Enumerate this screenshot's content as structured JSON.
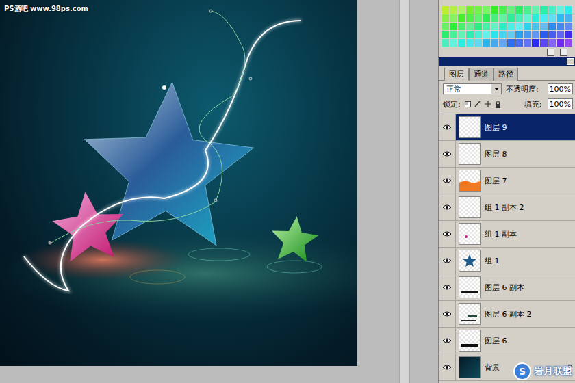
{
  "canvas": {
    "watermark": "PS酒吧 www.98ps.com"
  },
  "layers_panel": {
    "tabs": [
      {
        "label": "图层",
        "selected": true
      },
      {
        "label": "通道",
        "selected": false
      },
      {
        "label": "路径",
        "selected": false
      }
    ],
    "blend_mode": "正常",
    "opacity_label": "不透明度:",
    "opacity": "100%",
    "lock_label": "锁定:",
    "fill_label": "填充:",
    "fill": "100%",
    "layers": [
      {
        "name": "图层 9",
        "visible": true,
        "selected": true,
        "locked": false,
        "kind": "empty"
      },
      {
        "name": "图层 8",
        "visible": true,
        "selected": false,
        "locked": false,
        "kind": "empty"
      },
      {
        "name": "图层 7",
        "visible": true,
        "selected": false,
        "locked": false,
        "kind": "orange"
      },
      {
        "name": "组 1 副本 2",
        "visible": true,
        "selected": false,
        "locked": false,
        "kind": "empty"
      },
      {
        "name": "组 1 副本",
        "visible": true,
        "selected": false,
        "locked": false,
        "kind": "dot"
      },
      {
        "name": "组 1",
        "visible": true,
        "selected": false,
        "locked": false,
        "kind": "star"
      },
      {
        "name": "图层 6 副本",
        "visible": true,
        "selected": false,
        "locked": false,
        "kind": "bar"
      },
      {
        "name": "图层 6 副本 2",
        "visible": true,
        "selected": false,
        "locked": false,
        "kind": "smallbar"
      },
      {
        "name": "图层 6",
        "visible": true,
        "selected": false,
        "locked": false,
        "kind": "bar"
      },
      {
        "name": "背景",
        "visible": true,
        "selected": false,
        "locked": true,
        "kind": "fill"
      }
    ]
  },
  "corner_watermark": {
    "text": "岩月联盟",
    "logo": "S"
  }
}
